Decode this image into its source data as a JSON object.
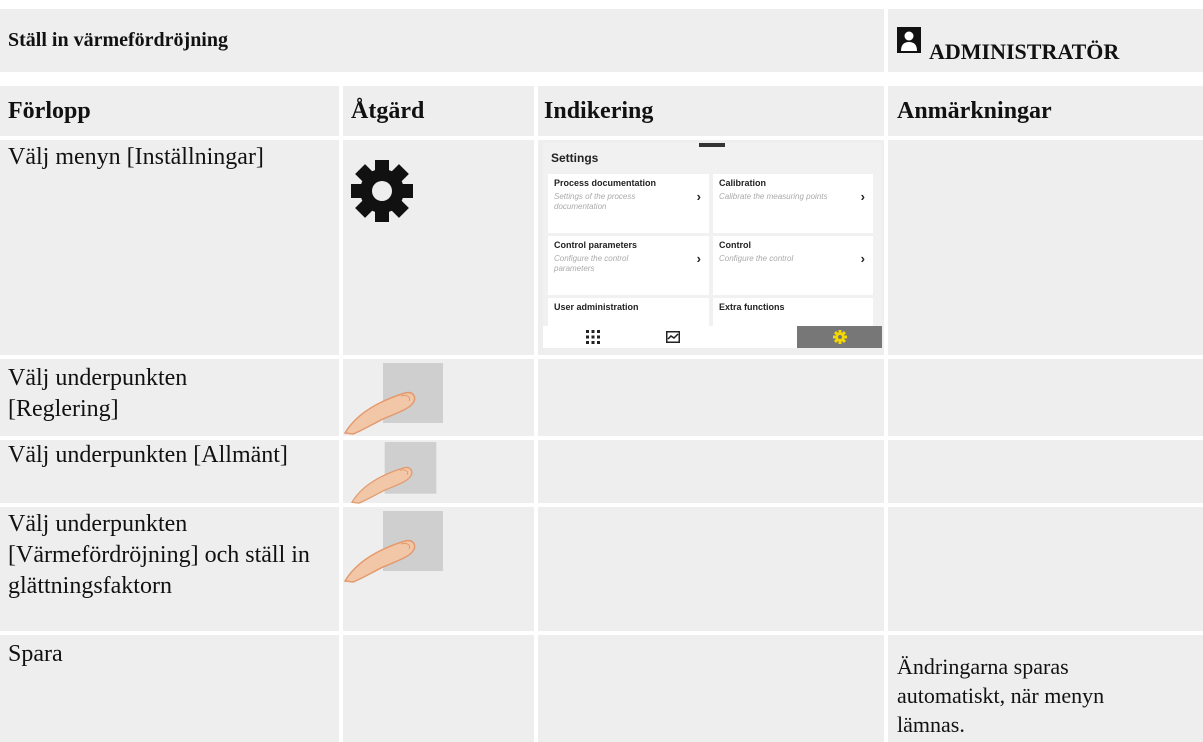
{
  "header": {
    "title": "Ställ in värmefördröjning",
    "role": "ADMINISTRATÖR",
    "role_icon": "person-icon"
  },
  "columns": [
    "Förlopp",
    "Åtgärd",
    "Indikering",
    "Anmärkningar"
  ],
  "rows": [
    {
      "step": "Välj menyn [Inställningar]",
      "action_icon": "gear-icon",
      "remark": ""
    },
    {
      "step": "Välj underpunkten [Reglering]",
      "action_icon": "finger-tap-icon",
      "remark": ""
    },
    {
      "step": "Välj underpunkten [Allmänt]",
      "action_icon": "finger-tap-icon",
      "remark": ""
    },
    {
      "step": "Välj underpunkten [Värmefördröjning] och ställ in glättningsfaktorn",
      "action_icon": "finger-tap-icon",
      "remark": ""
    },
    {
      "step": "Spara",
      "action_icon": "",
      "remark": "Ändringarna sparas automatiskt, när menyn lämnas."
    }
  ],
  "screen": {
    "title": "Settings",
    "tiles": [
      {
        "title": "Process documentation",
        "subtitle": "Settings of the process documentation"
      },
      {
        "title": "Calibration",
        "subtitle": "Calibrate the measuring points"
      },
      {
        "title": "Control parameters",
        "subtitle": "Configure the control parameters"
      },
      {
        "title": "Control",
        "subtitle": "Configure the control"
      },
      {
        "title": "User administration",
        "subtitle": ""
      },
      {
        "title": "Extra functions",
        "subtitle": ""
      }
    ],
    "nav": [
      "grid-icon",
      "chart-icon",
      "gear-icon"
    ],
    "active_color": "#f5d800"
  },
  "colors": {
    "cell_bg": "#eeeeee",
    "border": "#ffffff"
  }
}
